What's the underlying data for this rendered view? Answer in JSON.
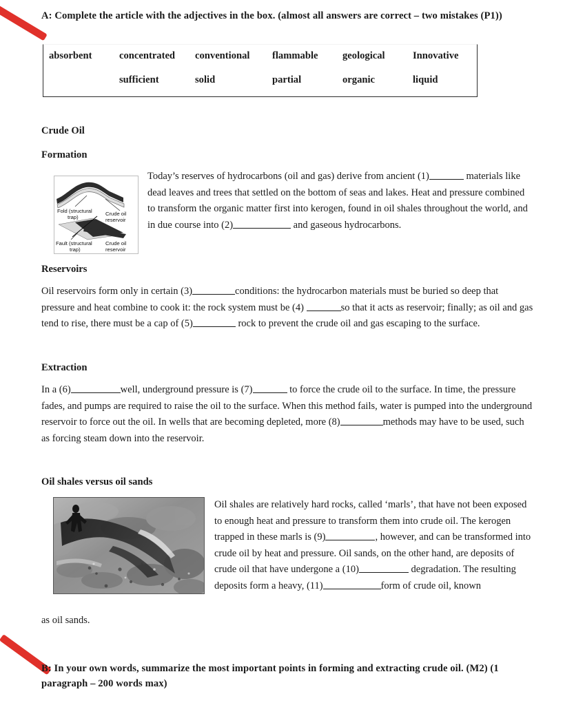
{
  "document": {
    "title": "Crude Oil worksheet",
    "accent_red": "#e0312a",
    "text_color": "#1a1a1a"
  },
  "annotations": {
    "arrow_top": "red-arrow-pointing-to-task-a",
    "arrow_bottom": "red-arrow-pointing-to-task-b"
  },
  "task_a": {
    "heading": "A: Complete the article with the adjectives in the box.  (almost all answers are correct – two mistakes (P1))"
  },
  "word_box": {
    "rows": [
      [
        "absorbent",
        "concentrated",
        "conventional",
        "flammable",
        "geological",
        "Innovative"
      ],
      [
        "",
        "sufficient",
        "solid",
        "partial",
        "organic",
        "liquid"
      ]
    ]
  },
  "article": {
    "title": "Crude Oil",
    "sections": [
      {
        "heading": "Formation",
        "paragraph_parts": [
          "Today’s reserves of hydrocarbons (oil and gas) derive from ancient (1)",
          "materials like dead leaves and trees that settled on the bottom of seas and lakes. Heat and pressure combined to transform the organic matter first into kerogen, found in oil shales throughout the world, and in due course into (2)",
          "and gaseous hydrocarbons."
        ]
      },
      {
        "heading": "Reservoirs",
        "paragraph_parts": [
          "Oil reservoirs form only in certain (3)",
          "conditions: the hydrocarbon materials must be buried so deep that pressure and heat combine to cook it: the rock system must be (4)",
          "so that it acts as reservoir; finally; as oil and gas tend to rise, there must be a cap of (5)",
          "rock to prevent the crude oil and gas escaping to the surface."
        ]
      },
      {
        "heading": "Extraction",
        "paragraph_parts": [
          "In a (6)",
          "well, underground pressure is (7)",
          "to force the crude oil to the surface. In time, the pressure fades, and pumps are required to raise the oil to the surface. When this method fails, water is pumped into the underground reservoir to force out the oil. In wells that are becoming depleted, more (8)",
          "methods may have to be used, such as forcing steam down into the reservoir."
        ]
      },
      {
        "heading": "Oil shales versus oil sands",
        "paragraph_parts": [
          "Oil shales are relatively hard rocks, called ‘marls’, that have not been exposed to enough heat and pressure to transform them into crude oil. The kerogen trapped in these marls is (9)",
          ", however, and can be transformed into crude oil by heat and pressure. Oil sands, on the other hand, are deposits of crude oil that have undergone a (10)",
          "degradation. The resulting deposits form a heavy, (11)",
          "form of crude oil, known"
        ],
        "continuation": "as oil sands."
      }
    ]
  },
  "figures": {
    "trap_diagram": {
      "name": "structural-trap-diagram",
      "labels": [
        "Fold (structural trap)",
        "Crude oil reservoir",
        "Fault (structural trap)",
        "Crude oil reservoir"
      ],
      "label_fold": "Fold (structural",
      "label_fold2": "trap)",
      "label_res1": "Crude oil",
      "label_res1b": "reservoir",
      "label_fault": "Fault (structural",
      "label_fault2": "trap)",
      "label_res2": "Crude oil",
      "label_res2b": "reservoir"
    },
    "rock_photo": {
      "name": "oil-shale-outcrop-photo",
      "alt": "Black and white photograph of a person standing beside a dark rocky oil-shale outcrop"
    }
  },
  "task_b": {
    "heading": "B: In your own words, summarize the most important points in forming and extracting crude oil. (M2) (1 paragraph – 200 words max)"
  }
}
